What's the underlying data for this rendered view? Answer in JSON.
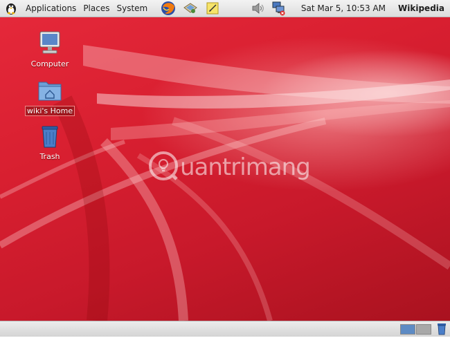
{
  "top_panel": {
    "menus": [
      "Applications",
      "Places",
      "System"
    ],
    "launchers": [
      "firefox-icon",
      "mail-icon",
      "notes-icon"
    ],
    "tray": [
      "volume-icon",
      "network-icon"
    ],
    "clock": "Sat Mar  5, 10:53 AM",
    "user": "Wikipedia"
  },
  "desktop": {
    "icons": [
      {
        "label": "Computer",
        "icon": "computer-icon"
      },
      {
        "label": "wiki's Home",
        "icon": "home-folder-icon",
        "selected": true
      },
      {
        "label": "Trash",
        "icon": "trash-icon"
      }
    ],
    "watermark": "uantrimang",
    "colors": {
      "wallpaper": "#d81f30",
      "panel": "#e4e4e4"
    }
  },
  "bottom_panel": {
    "workspaces": 2,
    "active_workspace": 1
  }
}
